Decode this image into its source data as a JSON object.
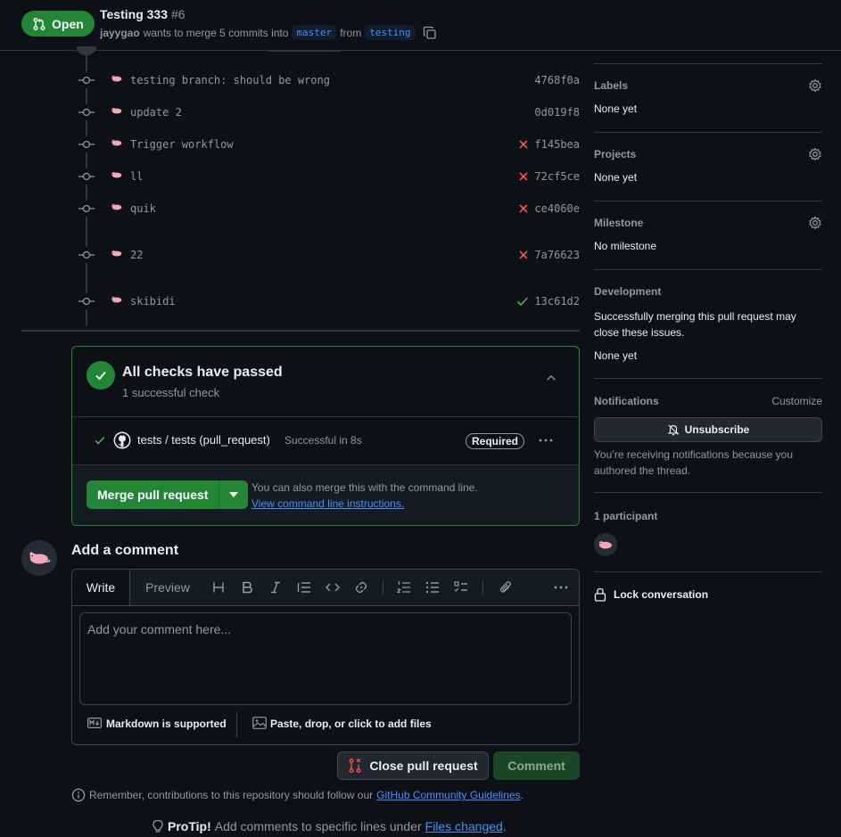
{
  "header": {
    "status": "Open",
    "title": "Testing 333",
    "number": "#6",
    "author": "jayygao",
    "merge_text": "wants to merge 5 commits into",
    "base_branch": "master",
    "from_text": "from",
    "head_branch": "testing"
  },
  "commits": [
    {
      "message": "testing branch: should be wrong",
      "sha": "4768f0a",
      "status": "none"
    },
    {
      "message": "update 2",
      "sha": "0d019f8",
      "status": "none"
    },
    {
      "message": "Trigger workflow",
      "sha": "f145bea",
      "status": "fail"
    },
    {
      "message": "ll",
      "sha": "72cf5ce",
      "status": "fail"
    },
    {
      "message": "quik",
      "sha": "ce4060e",
      "status": "fail"
    },
    {
      "message": "22",
      "sha": "7a76623",
      "status": "fail"
    },
    {
      "message": "skibidi",
      "sha": "13c61d2",
      "status": "pass"
    }
  ],
  "checks": {
    "title": "All checks have passed",
    "subtitle": "1 successful check",
    "check_name": "tests / tests (pull_request)",
    "check_status": "Successful in 8s",
    "required_label": "Required",
    "merge_button": "Merge pull request",
    "merge_hint": "You can also merge this with the command line.",
    "merge_link": "View command line instructions."
  },
  "comment": {
    "heading": "Add a comment",
    "tab_write": "Write",
    "tab_preview": "Preview",
    "placeholder": "Add your comment here...",
    "markdown_label": "Markdown is supported",
    "files_label": "Paste, drop, or click to add files",
    "close_button": "Close pull request",
    "comment_button": "Comment",
    "guidelines_prefix": "Remember, contributions to this repository should follow our",
    "guidelines_link": "GitHub Community Guidelines",
    "guidelines_suffix": ".",
    "protip_label": "ProTip!",
    "protip_text": "Add comments to specific lines under",
    "protip_link": "Files changed",
    "protip_suffix": "."
  },
  "sidebar": {
    "labels_heading": "Labels",
    "labels_value": "None yet",
    "projects_heading": "Projects",
    "projects_value": "None yet",
    "milestone_heading": "Milestone",
    "milestone_value": "No milestone",
    "development_heading": "Development",
    "development_text": "Successfully merging this pull request may close these issues.",
    "development_value": "None yet",
    "notifications_heading": "Notifications",
    "customize_label": "Customize",
    "unsubscribe_button": "Unsubscribe",
    "notifications_text": "You’re receiving notifications because you authored the thread.",
    "participants": "1 participant",
    "lock_label": "Lock conversation"
  },
  "colors": {
    "success": "#238636",
    "fail": "#f85149",
    "link": "#4493f8"
  }
}
